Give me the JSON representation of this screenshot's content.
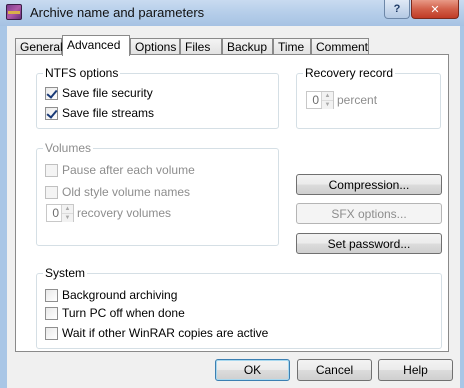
{
  "window": {
    "title": "Archive name and parameters",
    "help_glyph": "?",
    "close_glyph": "✕"
  },
  "tabs": [
    {
      "label": "General"
    },
    {
      "label": "Advanced",
      "active": true
    },
    {
      "label": "Options"
    },
    {
      "label": "Files"
    },
    {
      "label": "Backup"
    },
    {
      "label": "Time"
    },
    {
      "label": "Comment"
    }
  ],
  "ntfs": {
    "title": "NTFS options",
    "save_security": {
      "label": "Save file security",
      "checked": true
    },
    "save_streams": {
      "label": "Save file streams",
      "checked": true
    }
  },
  "recovery": {
    "title": "Recovery record",
    "value": "0",
    "unit": "percent"
  },
  "volumes": {
    "title": "Volumes",
    "pause": {
      "label": "Pause after each volume",
      "checked": false
    },
    "old_style": {
      "label": "Old style volume names",
      "checked": false
    },
    "recovery_value": "0",
    "recovery_label": "recovery volumes"
  },
  "side_buttons": {
    "compression": "Compression...",
    "sfx": "SFX options...",
    "password": "Set password..."
  },
  "system": {
    "title": "System",
    "background": {
      "label": "Background archiving",
      "checked": false
    },
    "turn_off": {
      "label": "Turn PC off when done",
      "checked": false
    },
    "wait": {
      "label": "Wait if other WinRAR copies are active",
      "checked": false
    }
  },
  "footer": {
    "ok": "OK",
    "cancel": "Cancel",
    "help": "Help"
  },
  "colors": {
    "frame": "#a9c6e6",
    "close_button": "#c9473a",
    "dialog_bg": "#f0f0f0"
  }
}
